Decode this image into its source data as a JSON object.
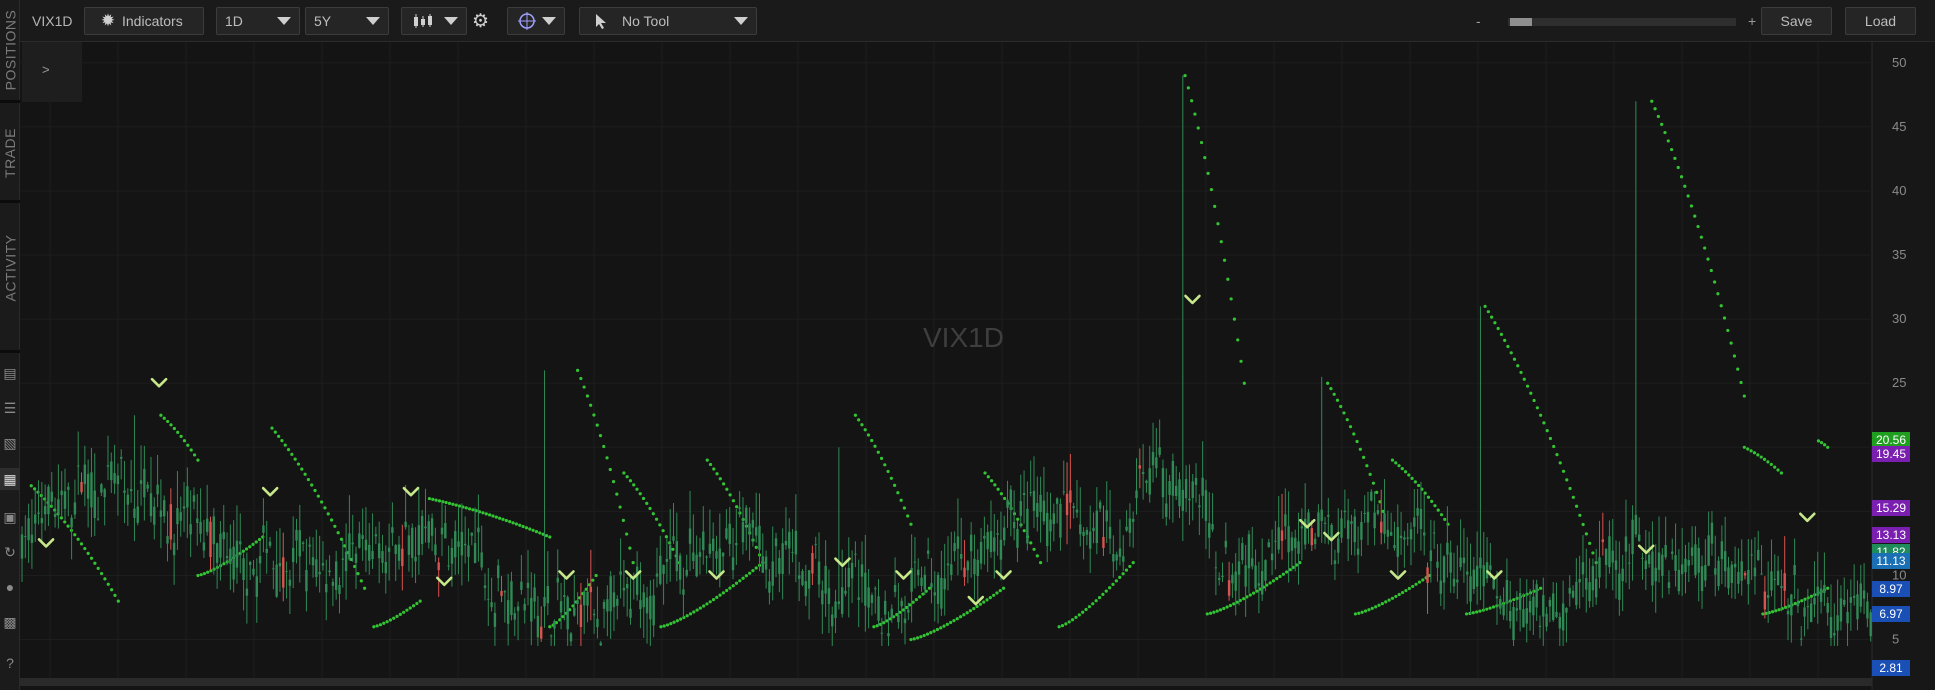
{
  "sidebar": {
    "tabs": [
      {
        "label": "POSITIONS"
      },
      {
        "label": "TRADE"
      },
      {
        "label": "ACTIVITY"
      }
    ],
    "icons": [
      "report-icon",
      "list-icon",
      "tv-icon",
      "grid-chart-icon",
      "layout-icon",
      "history-icon",
      "people-icon",
      "calendar-icon",
      "help-icon"
    ]
  },
  "toolbar": {
    "symbol": "VIX1D",
    "indicators_label": "Indicators",
    "interval": "1D",
    "range": "5Y",
    "tool": "No Tool",
    "zoom_minus": "-",
    "zoom_plus": "+",
    "zoom_level": 0.09,
    "save_label": "Save",
    "load_label": "Load"
  },
  "positions_toggle": ">",
  "chart_data": {
    "type": "candlestick",
    "watermark": "VIX1D",
    "y_ticks": [
      5,
      10,
      15,
      20,
      25,
      30,
      35,
      40,
      45,
      50
    ],
    "ylim": [
      2,
      51
    ],
    "colors": {
      "up": "#2f8a55",
      "down": "#d9534f",
      "sar": "#33c433",
      "signal": "#c6e88a",
      "background": "#141414"
    },
    "price_tags": [
      {
        "value": "20.56",
        "color": "#1f9e1f"
      },
      {
        "value": "19.45",
        "color": "#7a1fb0"
      },
      {
        "value": "15.29",
        "color": "#7a1fb0"
      },
      {
        "value": "13.13",
        "color": "#7a1fb0"
      },
      {
        "value": "11.82",
        "color": "#1f8a5a"
      },
      {
        "value": "11.13",
        "color": "#1a6fb5"
      },
      {
        "value": "8.97",
        "color": "#1a4fb5"
      },
      {
        "value": "6.97",
        "color": "#1a4fb5"
      },
      {
        "value": "2.81",
        "color": "#1a4fb5"
      }
    ],
    "spikes": [
      {
        "pos": 0.06,
        "high": 22.5
      },
      {
        "pos": 0.283,
        "high": 26
      },
      {
        "pos": 0.441,
        "high": 20
      },
      {
        "pos": 0.626,
        "high": 49
      },
      {
        "pos": 0.702,
        "high": 25.5
      },
      {
        "pos": 0.787,
        "high": 31
      },
      {
        "pos": 0.872,
        "high": 47
      }
    ],
    "signals": [
      {
        "pos": 0.013,
        "value": 12.5
      },
      {
        "pos": 0.074,
        "value": 25
      },
      {
        "pos": 0.134,
        "value": 16.5
      },
      {
        "pos": 0.21,
        "value": 16.5
      },
      {
        "pos": 0.228,
        "value": 9.5
      },
      {
        "pos": 0.294,
        "value": 10
      },
      {
        "pos": 0.33,
        "value": 10
      },
      {
        "pos": 0.375,
        "value": 10
      },
      {
        "pos": 0.443,
        "value": 11
      },
      {
        "pos": 0.476,
        "value": 10
      },
      {
        "pos": 0.515,
        "value": 8
      },
      {
        "pos": 0.53,
        "value": 10
      },
      {
        "pos": 0.632,
        "value": 31.5
      },
      {
        "pos": 0.694,
        "value": 14
      },
      {
        "pos": 0.707,
        "value": 13
      },
      {
        "pos": 0.743,
        "value": 10
      },
      {
        "pos": 0.795,
        "value": 10
      },
      {
        "pos": 0.877,
        "value": 12
      },
      {
        "pos": 0.964,
        "value": 14.5
      }
    ],
    "sar_segments": [
      {
        "start": 0.005,
        "end": 0.052,
        "from": 17,
        "to": 8
      },
      {
        "start": 0.075,
        "end": 0.095,
        "from": 22.5,
        "to": 19
      },
      {
        "start": 0.095,
        "end": 0.13,
        "from": 10,
        "to": 13
      },
      {
        "start": 0.135,
        "end": 0.185,
        "from": 21.5,
        "to": 9
      },
      {
        "start": 0.19,
        "end": 0.215,
        "from": 6,
        "to": 8
      },
      {
        "start": 0.22,
        "end": 0.285,
        "from": 16,
        "to": 13
      },
      {
        "start": 0.285,
        "end": 0.31,
        "from": 6,
        "to": 10
      },
      {
        "start": 0.3,
        "end": 0.33,
        "from": 26,
        "to": 11
      },
      {
        "start": 0.325,
        "end": 0.355,
        "from": 18,
        "to": 11
      },
      {
        "start": 0.345,
        "end": 0.4,
        "from": 6,
        "to": 11
      },
      {
        "start": 0.37,
        "end": 0.4,
        "from": 19,
        "to": 11
      },
      {
        "start": 0.45,
        "end": 0.48,
        "from": 22.5,
        "to": 14
      },
      {
        "start": 0.46,
        "end": 0.49,
        "from": 6,
        "to": 9
      },
      {
        "start": 0.52,
        "end": 0.55,
        "from": 18,
        "to": 11
      },
      {
        "start": 0.48,
        "end": 0.53,
        "from": 5,
        "to": 9
      },
      {
        "start": 0.56,
        "end": 0.6,
        "from": 6,
        "to": 11
      },
      {
        "start": 0.628,
        "end": 0.66,
        "from": 49,
        "to": 25
      },
      {
        "start": 0.64,
        "end": 0.69,
        "from": 7,
        "to": 11
      },
      {
        "start": 0.705,
        "end": 0.735,
        "from": 25,
        "to": 15
      },
      {
        "start": 0.72,
        "end": 0.76,
        "from": 7,
        "to": 10
      },
      {
        "start": 0.74,
        "end": 0.77,
        "from": 19,
        "to": 14
      },
      {
        "start": 0.79,
        "end": 0.85,
        "from": 31,
        "to": 11
      },
      {
        "start": 0.78,
        "end": 0.82,
        "from": 7,
        "to": 9
      },
      {
        "start": 0.88,
        "end": 0.93,
        "from": 47,
        "to": 24
      },
      {
        "start": 0.93,
        "end": 0.95,
        "from": 20,
        "to": 18
      },
      {
        "start": 0.94,
        "end": 0.975,
        "from": 7,
        "to": 9
      },
      {
        "start": 0.97,
        "end": 0.975,
        "from": 20.5,
        "to": 20
      }
    ]
  }
}
